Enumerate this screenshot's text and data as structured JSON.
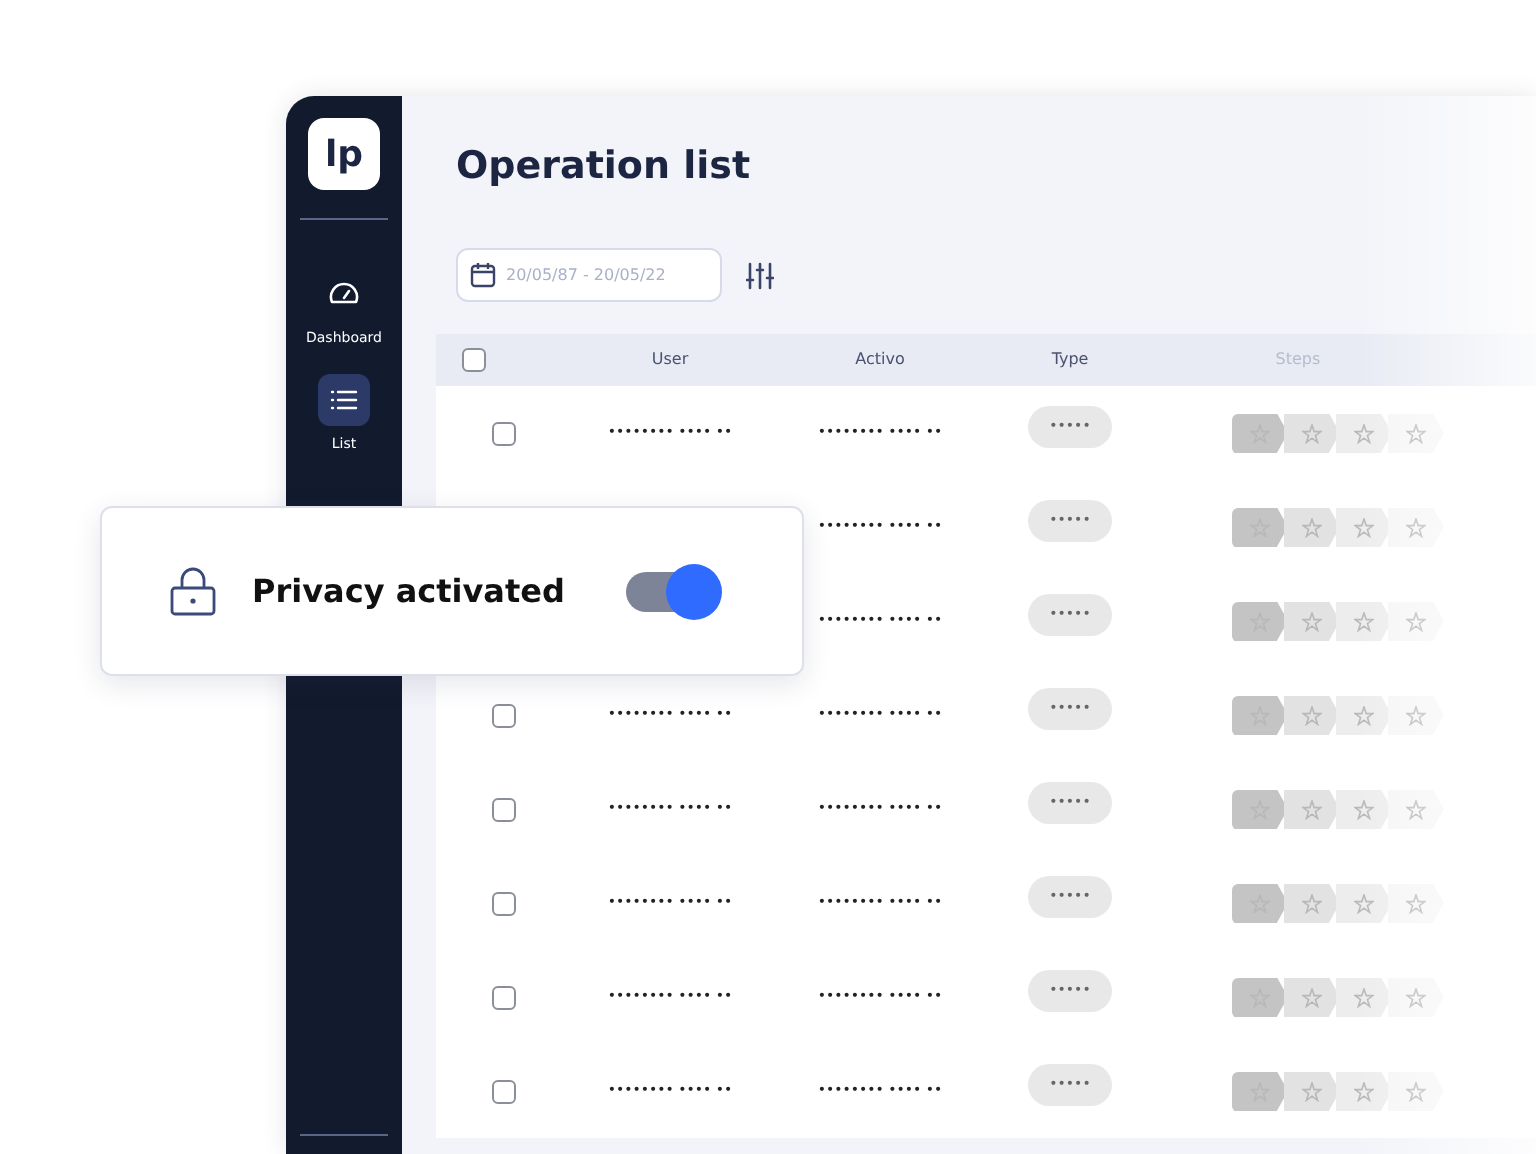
{
  "logo": "lp",
  "sidebar": {
    "items": [
      {
        "label": "Dashboard",
        "kind": "gauge",
        "selected": false
      },
      {
        "label": "List",
        "kind": "list",
        "selected": true
      }
    ]
  },
  "page_title": "Operation list",
  "date_filter": {
    "value": "20/05/87 - 20/05/22"
  },
  "table": {
    "header_checked": false,
    "columns": [
      "User",
      "Activo",
      "Type",
      "Steps"
    ],
    "rows": [
      {
        "checked": false,
        "user": "•••••••• •••• ••",
        "activo": "•••••••• •••• ••",
        "type": "•••••"
      },
      {
        "activo": "•••••••• •••• ••",
        "type": "•••••"
      },
      {
        "activo": "•••••••• •••• ••",
        "type": "•••••"
      },
      {
        "checked": false,
        "user": "•••••••• •••• ••",
        "activo": "•••••••• •••• ••",
        "type": "•••••"
      },
      {
        "checked": false,
        "user": "•••••••• •••• ••",
        "activo": "•••••••• •••• ••",
        "type": "•••••"
      },
      {
        "checked": false,
        "user": "•••••••• •••• ••",
        "activo": "•••••••• •••• ••",
        "type": "•••••"
      },
      {
        "checked": false,
        "user": "•••••••• •••• ••",
        "activo": "•••••••• •••• ••",
        "type": "•••••"
      },
      {
        "checked": false,
        "user": "•••••••• •••• ••",
        "activo": "•••••••• •••• ••",
        "type": "•••••"
      }
    ]
  },
  "privacy_card": {
    "label": "Privacy activated",
    "on": true
  }
}
